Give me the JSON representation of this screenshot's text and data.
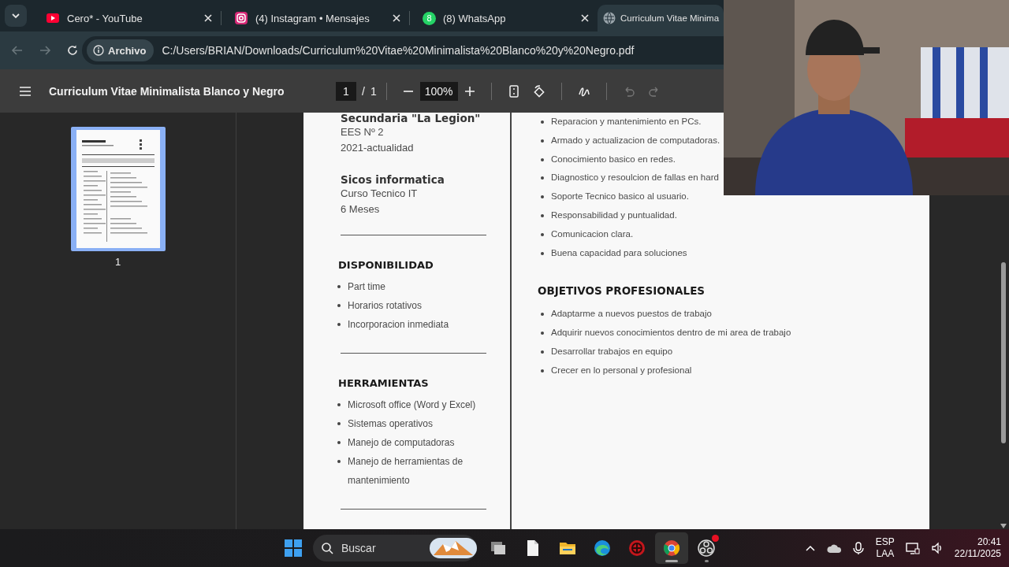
{
  "browser": {
    "tabs": [
      {
        "kind": "youtube",
        "title": "Cero* - YouTube",
        "selected": false
      },
      {
        "kind": "instagram",
        "title": "(4) Instagram • Mensajes",
        "selected": false
      },
      {
        "kind": "whatsapp",
        "badge": "8",
        "title": "(8) WhatsApp",
        "selected": false
      },
      {
        "kind": "globe",
        "title": "Curriculum Vitae Minima",
        "selected": true
      }
    ],
    "address": {
      "badge": "Archivo",
      "url": "C:/Users/BRIAN/Downloads/Curriculum%20Vitae%20Minimalista%20Blanco%20y%20Negro.pdf"
    }
  },
  "pdf_toolbar": {
    "title": "Curriculum Vitae Minimalista Blanco y Negro",
    "page": "1",
    "separator": "/",
    "page_total": "1",
    "zoom": "100%",
    "history": [
      {
        "kind": "undo",
        "disabled": true
      },
      {
        "kind": "redo",
        "disabled": true
      }
    ]
  },
  "thumbnails": [
    {
      "label": "1",
      "selected": true
    }
  ],
  "document": {
    "left": [
      {
        "kind": "entry",
        "heading": "Secundaria \"La Legion\"",
        "lines": [
          "EES Nº 2",
          "2021-actualidad"
        ]
      },
      {
        "kind": "entry",
        "heading": "Sicos informatica",
        "lines": [
          "Curso Tecnico IT",
          "6 Meses"
        ]
      },
      {
        "kind": "rule"
      },
      {
        "kind": "section",
        "heading": "DISPONIBILIDAD",
        "items": [
          "Part time",
          "Horarios rotativos",
          "Incorporacion inmediata"
        ]
      },
      {
        "kind": "rule"
      },
      {
        "kind": "section",
        "heading": "HERRAMIENTAS",
        "items": [
          "Microsoft office (Word y Excel)",
          "Sistemas operativos",
          "Manejo de computadoras",
          "Manejo de herramientas de mantenimiento"
        ]
      },
      {
        "kind": "rule"
      }
    ],
    "right": [
      {
        "kind": "list",
        "items": [
          "Reparacion y mantenimiento en PCs.",
          "Armado y actualizacion de computadoras.",
          "Conocimiento basico en redes.",
          "Diagnostico y resoulcion de fallas en hard",
          "Soporte Tecnico basico al usuario.",
          "Responsabilidad y puntualidad.",
          "Comunicacion clara.",
          "Buena capacidad para soluciones"
        ]
      },
      {
        "kind": "section",
        "heading": "OBJETIVOS PROFESIONALES",
        "items": [
          "Adaptarme a nuevos puestos de trabajo",
          "Adquirir nuevos conocimientos dentro de mi area de trabajo",
          "Desarrollar trabajos en equipo",
          "Crecer en lo personal y profesional"
        ]
      }
    ]
  },
  "taskbar": {
    "search_placeholder": "Buscar",
    "apps": [
      {
        "kind": "taskview",
        "running": false,
        "selected": false,
        "notification": false
      },
      {
        "kind": "file",
        "running": false,
        "selected": false,
        "notification": false
      },
      {
        "kind": "folder",
        "running": false,
        "selected": false,
        "notification": false
      },
      {
        "kind": "edge",
        "running": false,
        "selected": false,
        "notification": false
      },
      {
        "kind": "shield",
        "running": false,
        "selected": false,
        "notification": false
      },
      {
        "kind": "chrome",
        "running": true,
        "selected": true,
        "notification": false
      },
      {
        "kind": "obs",
        "running": true,
        "selected": false,
        "notification": true
      }
    ],
    "language": "ESP",
    "layout": "LAA",
    "time": "20:41",
    "date": "22/11/2025"
  }
}
